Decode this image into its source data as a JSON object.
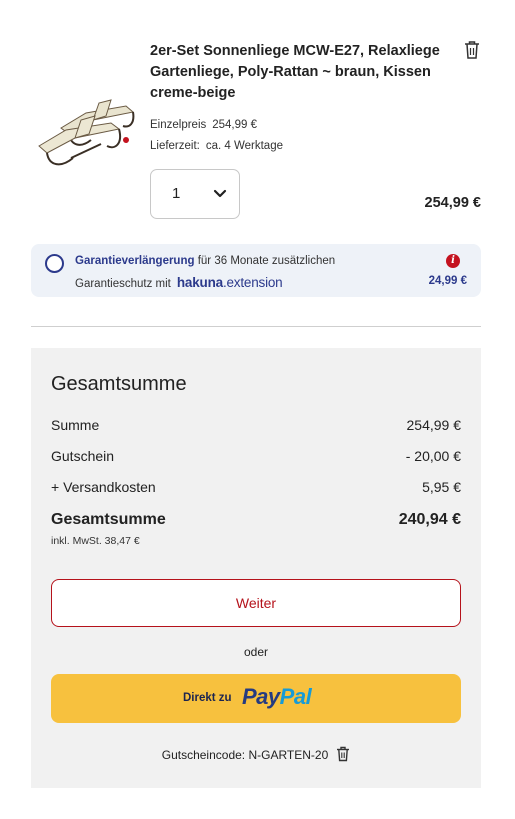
{
  "product": {
    "title": "2er-Set Sonnenliege MCW-E27, Relaxliege Gartenliege, Poly-Rattan ~ braun, Kissen creme-beige",
    "unit_price_label": "Einzelpreis",
    "unit_price": "254,99 €",
    "delivery_label": "Lieferzeit:",
    "delivery": "ca. 4 Werktage",
    "quantity": "1",
    "line_total": "254,99 €"
  },
  "warranty": {
    "name": "Garantieverlängerung",
    "text_rest": " für 36 Monate zusätzlichen",
    "line2": "Garantieschutz mit",
    "brand_bold": "hakuna",
    "brand_rest": ".extension",
    "info_glyph": "i",
    "price": "24,99 €"
  },
  "summary": {
    "title": "Gesamtsumme",
    "rows": [
      {
        "label": "Summe",
        "value": "254,99 €"
      },
      {
        "label": "Gutschein",
        "value": "- 20,00 €"
      },
      {
        "label": "+ Versandkosten",
        "value": "5,95 €"
      }
    ],
    "total_label": "Gesamtsumme",
    "total_value": "240,94 €",
    "tax_note": "inkl. MwSt. 38,47 €",
    "continue_label": "Weiter",
    "or_label": "oder",
    "paypal_prefix": "Direkt zu",
    "paypal_word1": "Pay",
    "paypal_word2": "Pal",
    "coupon_text": "Gutscheincode: N-GARTEN-20"
  },
  "colors": {
    "accent_red": "#b5121b",
    "brand_blue": "#2c3a8c",
    "paypal_yellow": "#f7c13e",
    "panel_gray": "#f1f1f1"
  },
  "icons": [
    "trash-icon",
    "chevron-down-icon",
    "info-icon",
    "radio-icon"
  ]
}
